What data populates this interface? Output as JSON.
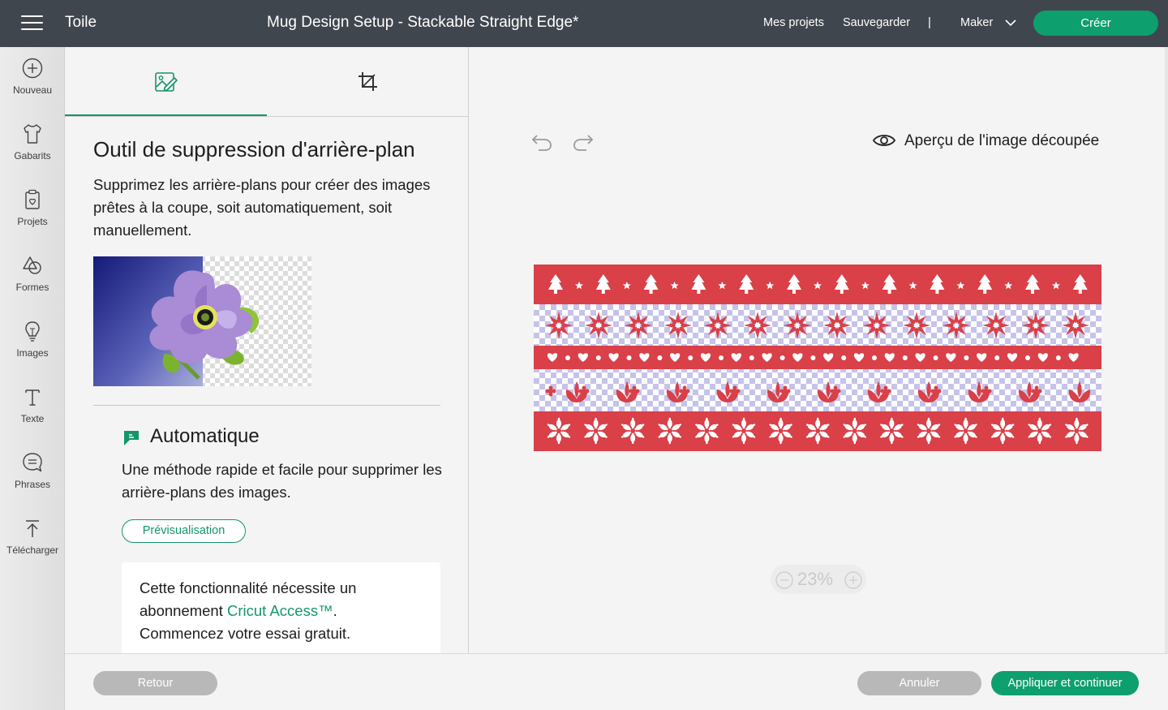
{
  "header": {
    "app_title": "Toile",
    "doc_title": "Mug Design Setup - Stackable Straight Edge*",
    "my_projects": "Mes projets",
    "save": "Sauvegarder",
    "separator": "|",
    "machine": "Maker",
    "create": "Créer"
  },
  "sidebar": {
    "items": [
      {
        "label": "Nouveau",
        "icon": "plus-circle-icon"
      },
      {
        "label": "Gabarits",
        "icon": "tshirt-icon"
      },
      {
        "label": "Projets",
        "icon": "clipboard-icon"
      },
      {
        "label": "Formes",
        "icon": "shapes-icon"
      },
      {
        "label": "Images",
        "icon": "lightbulb-icon"
      },
      {
        "label": "Texte",
        "icon": "text-icon"
      },
      {
        "label": "Phrases",
        "icon": "speech-bubble-icon"
      },
      {
        "label": "Télécharger",
        "icon": "upload-icon"
      }
    ]
  },
  "panel": {
    "tabs": [
      {
        "name": "background-remover",
        "icon": "image-edit-icon",
        "active": true
      },
      {
        "name": "crop",
        "icon": "crop-icon",
        "active": false
      }
    ],
    "title": "Outil de suppression d'arrière-plan",
    "description": "Supprimez les arrière-plans pour créer des images prêtes à la coupe, soit automatiquement, soit manuellement.",
    "auto": {
      "title": "Automatique",
      "description": "Une méthode rapide et facile pour supprimer les arrière-plans des images.",
      "preview_button": "Prévisualisation"
    },
    "subscription": {
      "text_before": "Cette fonctionnalité nécessite un abonnement ",
      "link": "Cricut Access™",
      "text_after": ". Commencez votre essai gratuit."
    }
  },
  "canvas": {
    "preview_label": "Aperçu de l'image découpée",
    "zoom": "23%"
  },
  "footer": {
    "back": "Retour",
    "cancel": "Annuler",
    "apply": "Appliquer et continuer"
  },
  "colors": {
    "accent": "#13966a",
    "topbar": "#40464d",
    "pattern_red": "#d94048",
    "pattern_lavender": "#c6c3ea"
  }
}
